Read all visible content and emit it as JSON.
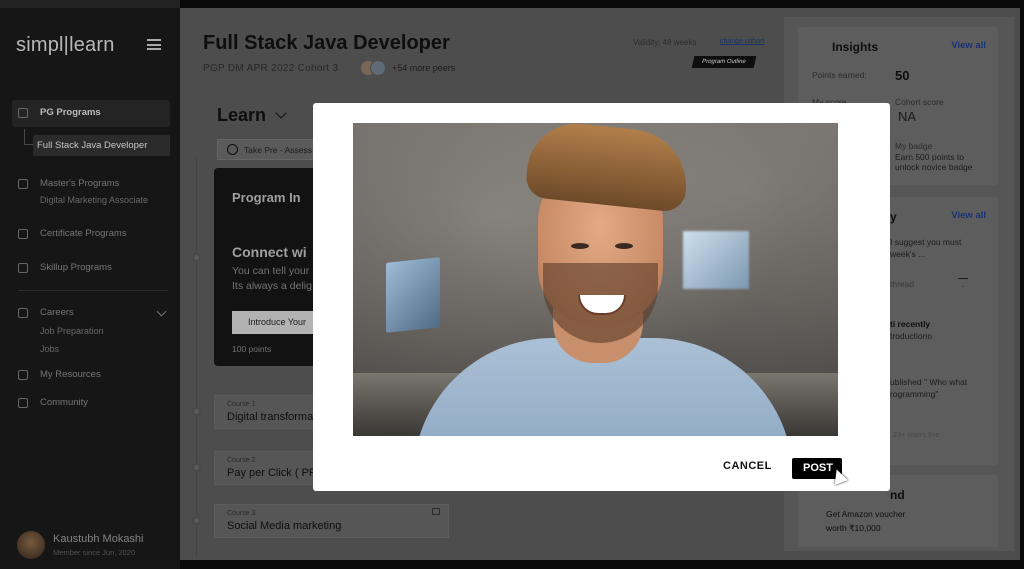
{
  "sidebar": {
    "logo": "simpl|learn",
    "items": [
      {
        "label": "PG Programs"
      },
      {
        "label": "Full Stack Java Developer"
      },
      {
        "label": "Master's Programs",
        "sub": "Digital Marketing Associate"
      },
      {
        "label": "Certificate Programs"
      },
      {
        "label": "Skillup Programs"
      },
      {
        "label": "Careers",
        "subs": [
          "Job Preparation",
          "Jobs"
        ]
      },
      {
        "label": "My Resources"
      },
      {
        "label": "Community"
      }
    ],
    "user": {
      "name": "Kaustubh Mokashi",
      "meta": "Member since Jun, 2020"
    }
  },
  "main": {
    "title": "Full Stack Java Developer",
    "subtitle": "PGP DM APR 2022 Cohort 3",
    "peers": "+54 more peers",
    "validity": "Validity: 48 weeks",
    "change_cohort": "change cohort",
    "program_outline": "Program Outline",
    "section": "Learn",
    "pre_assessment": "Take Pre - Assess",
    "intro": {
      "title": "Program In",
      "connect": "Connect wi",
      "line1": "You can tell your",
      "line2": "Its always a delig",
      "button": "Introduce Your",
      "points": "100 points"
    },
    "courses": [
      {
        "label": "Course 1",
        "name": "Digital transforma"
      },
      {
        "label": "Course 2",
        "name": "Pay per Click ( PF"
      },
      {
        "label": "Course 3",
        "name": "Social Media marketing"
      }
    ]
  },
  "right": {
    "insights": {
      "title": "Insights",
      "view_all": "View all",
      "points_label": "Points earned:",
      "points_value": "50",
      "my_score": "My score",
      "cohort_score_label": "Cohort score",
      "cohort_score_value": "NA",
      "my_badge": "My badge",
      "badge_line1": "Earn 500 points to",
      "badge_line2": "unlock novice badge"
    },
    "activity": {
      "title": "y",
      "view_all": "View all",
      "line1": "I suggest you must",
      "line2": "week's ...",
      "thread_placeholder": "thread",
      "line3": "ti recently",
      "line4": "troductionn",
      "line5": "ublished \" Who what",
      "line6": "rogramming\"",
      "live": "23+ users live"
    },
    "refer": {
      "title": "nd",
      "line1": "Get Amazon voucher",
      "line2": "worth ₹10,000"
    }
  },
  "modal": {
    "cancel": "CANCEL",
    "post": "POST"
  }
}
